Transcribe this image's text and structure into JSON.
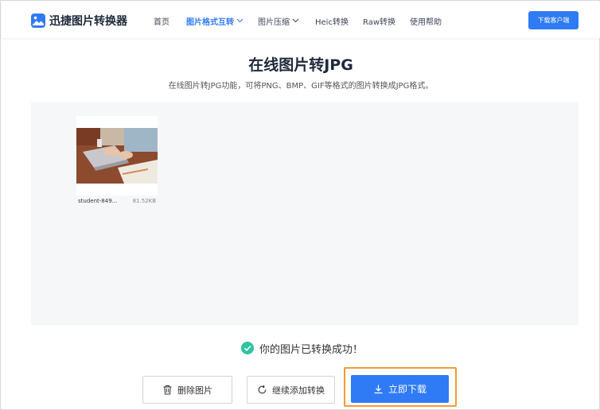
{
  "header": {
    "logo_text": "迅捷图片转换器",
    "nav": [
      {
        "label": "首页"
      },
      {
        "label": "图片格式互转",
        "active": true
      },
      {
        "label": "图片压缩"
      },
      {
        "label": "Heic转换"
      },
      {
        "label": "Raw转换"
      },
      {
        "label": "使用帮助"
      }
    ],
    "download_client_label": "下载客户端"
  },
  "page": {
    "title": "在线图片转JPG",
    "subtitle": "在线图片转JPG功能，可将PNG、BMP、GIF等格式的图片转换成JPG格式。"
  },
  "file": {
    "name": "student-849...",
    "size": "81.52KB"
  },
  "status": {
    "message": "你的图片已转换成功！"
  },
  "actions": {
    "delete_label": "删除图片",
    "continue_label": "继续添加转换",
    "download_label": "立即下载"
  },
  "colors": {
    "accent": "#2f7bf6",
    "success": "#2ec4a0",
    "highlight": "#f39c34"
  },
  "icons": [
    "logo-icon",
    "chevron-down-icon",
    "check-circle-icon",
    "trash-icon",
    "refresh-icon",
    "download-icon"
  ]
}
